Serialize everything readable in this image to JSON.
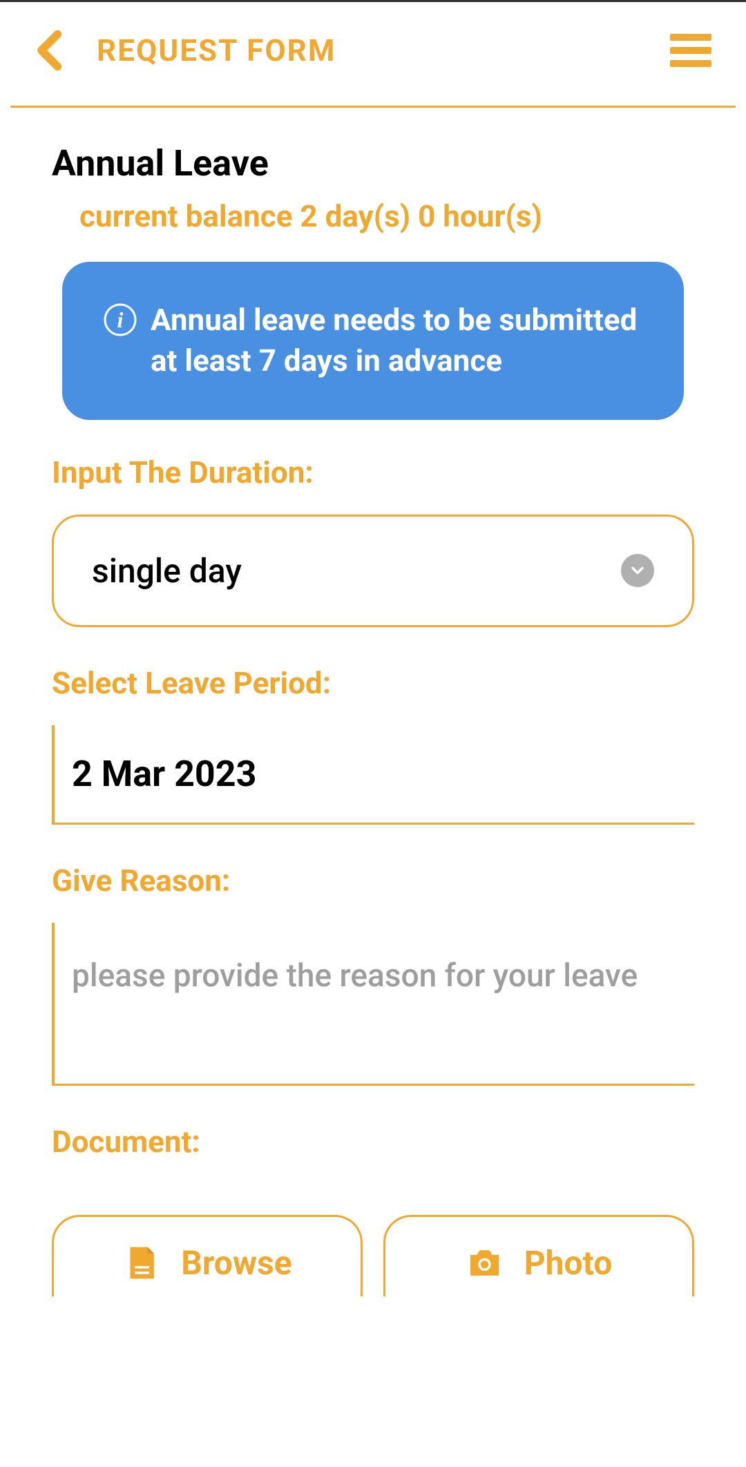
{
  "header": {
    "title": "REQUEST FORM"
  },
  "leave": {
    "type": "Annual Leave",
    "balance": "current balance 2 day(s) 0 hour(s)",
    "info": "Annual leave needs to be submitted at least 7 days in advance"
  },
  "form": {
    "duration_label": "Input The Duration:",
    "duration_value": "single day",
    "period_label": "Select Leave Period:",
    "period_value": "2 Mar 2023",
    "reason_label": "Give Reason:",
    "reason_placeholder": "please provide the reason for your leave",
    "document_label": "Document:"
  },
  "buttons": {
    "browse": "Browse",
    "photo": "Photo"
  },
  "colors": {
    "accent": "#F0A830",
    "info_bg": "#4A90E2"
  }
}
